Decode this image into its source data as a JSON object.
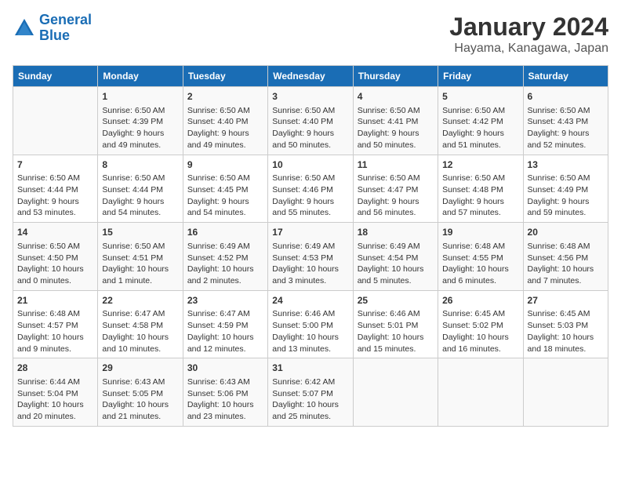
{
  "header": {
    "logo_line1": "General",
    "logo_line2": "Blue",
    "title": "January 2024",
    "subtitle": "Hayama, Kanagawa, Japan"
  },
  "weekdays": [
    "Sunday",
    "Monday",
    "Tuesday",
    "Wednesday",
    "Thursday",
    "Friday",
    "Saturday"
  ],
  "weeks": [
    [
      {
        "day": "",
        "info": ""
      },
      {
        "day": "1",
        "info": "Sunrise: 6:50 AM\nSunset: 4:39 PM\nDaylight: 9 hours\nand 49 minutes."
      },
      {
        "day": "2",
        "info": "Sunrise: 6:50 AM\nSunset: 4:40 PM\nDaylight: 9 hours\nand 49 minutes."
      },
      {
        "day": "3",
        "info": "Sunrise: 6:50 AM\nSunset: 4:40 PM\nDaylight: 9 hours\nand 50 minutes."
      },
      {
        "day": "4",
        "info": "Sunrise: 6:50 AM\nSunset: 4:41 PM\nDaylight: 9 hours\nand 50 minutes."
      },
      {
        "day": "5",
        "info": "Sunrise: 6:50 AM\nSunset: 4:42 PM\nDaylight: 9 hours\nand 51 minutes."
      },
      {
        "day": "6",
        "info": "Sunrise: 6:50 AM\nSunset: 4:43 PM\nDaylight: 9 hours\nand 52 minutes."
      }
    ],
    [
      {
        "day": "7",
        "info": "Sunrise: 6:50 AM\nSunset: 4:44 PM\nDaylight: 9 hours\nand 53 minutes."
      },
      {
        "day": "8",
        "info": "Sunrise: 6:50 AM\nSunset: 4:44 PM\nDaylight: 9 hours\nand 54 minutes."
      },
      {
        "day": "9",
        "info": "Sunrise: 6:50 AM\nSunset: 4:45 PM\nDaylight: 9 hours\nand 54 minutes."
      },
      {
        "day": "10",
        "info": "Sunrise: 6:50 AM\nSunset: 4:46 PM\nDaylight: 9 hours\nand 55 minutes."
      },
      {
        "day": "11",
        "info": "Sunrise: 6:50 AM\nSunset: 4:47 PM\nDaylight: 9 hours\nand 56 minutes."
      },
      {
        "day": "12",
        "info": "Sunrise: 6:50 AM\nSunset: 4:48 PM\nDaylight: 9 hours\nand 57 minutes."
      },
      {
        "day": "13",
        "info": "Sunrise: 6:50 AM\nSunset: 4:49 PM\nDaylight: 9 hours\nand 59 minutes."
      }
    ],
    [
      {
        "day": "14",
        "info": "Sunrise: 6:50 AM\nSunset: 4:50 PM\nDaylight: 10 hours\nand 0 minutes."
      },
      {
        "day": "15",
        "info": "Sunrise: 6:50 AM\nSunset: 4:51 PM\nDaylight: 10 hours\nand 1 minute."
      },
      {
        "day": "16",
        "info": "Sunrise: 6:49 AM\nSunset: 4:52 PM\nDaylight: 10 hours\nand 2 minutes."
      },
      {
        "day": "17",
        "info": "Sunrise: 6:49 AM\nSunset: 4:53 PM\nDaylight: 10 hours\nand 3 minutes."
      },
      {
        "day": "18",
        "info": "Sunrise: 6:49 AM\nSunset: 4:54 PM\nDaylight: 10 hours\nand 5 minutes."
      },
      {
        "day": "19",
        "info": "Sunrise: 6:48 AM\nSunset: 4:55 PM\nDaylight: 10 hours\nand 6 minutes."
      },
      {
        "day": "20",
        "info": "Sunrise: 6:48 AM\nSunset: 4:56 PM\nDaylight: 10 hours\nand 7 minutes."
      }
    ],
    [
      {
        "day": "21",
        "info": "Sunrise: 6:48 AM\nSunset: 4:57 PM\nDaylight: 10 hours\nand 9 minutes."
      },
      {
        "day": "22",
        "info": "Sunrise: 6:47 AM\nSunset: 4:58 PM\nDaylight: 10 hours\nand 10 minutes."
      },
      {
        "day": "23",
        "info": "Sunrise: 6:47 AM\nSunset: 4:59 PM\nDaylight: 10 hours\nand 12 minutes."
      },
      {
        "day": "24",
        "info": "Sunrise: 6:46 AM\nSunset: 5:00 PM\nDaylight: 10 hours\nand 13 minutes."
      },
      {
        "day": "25",
        "info": "Sunrise: 6:46 AM\nSunset: 5:01 PM\nDaylight: 10 hours\nand 15 minutes."
      },
      {
        "day": "26",
        "info": "Sunrise: 6:45 AM\nSunset: 5:02 PM\nDaylight: 10 hours\nand 16 minutes."
      },
      {
        "day": "27",
        "info": "Sunrise: 6:45 AM\nSunset: 5:03 PM\nDaylight: 10 hours\nand 18 minutes."
      }
    ],
    [
      {
        "day": "28",
        "info": "Sunrise: 6:44 AM\nSunset: 5:04 PM\nDaylight: 10 hours\nand 20 minutes."
      },
      {
        "day": "29",
        "info": "Sunrise: 6:43 AM\nSunset: 5:05 PM\nDaylight: 10 hours\nand 21 minutes."
      },
      {
        "day": "30",
        "info": "Sunrise: 6:43 AM\nSunset: 5:06 PM\nDaylight: 10 hours\nand 23 minutes."
      },
      {
        "day": "31",
        "info": "Sunrise: 6:42 AM\nSunset: 5:07 PM\nDaylight: 10 hours\nand 25 minutes."
      },
      {
        "day": "",
        "info": ""
      },
      {
        "day": "",
        "info": ""
      },
      {
        "day": "",
        "info": ""
      }
    ]
  ]
}
